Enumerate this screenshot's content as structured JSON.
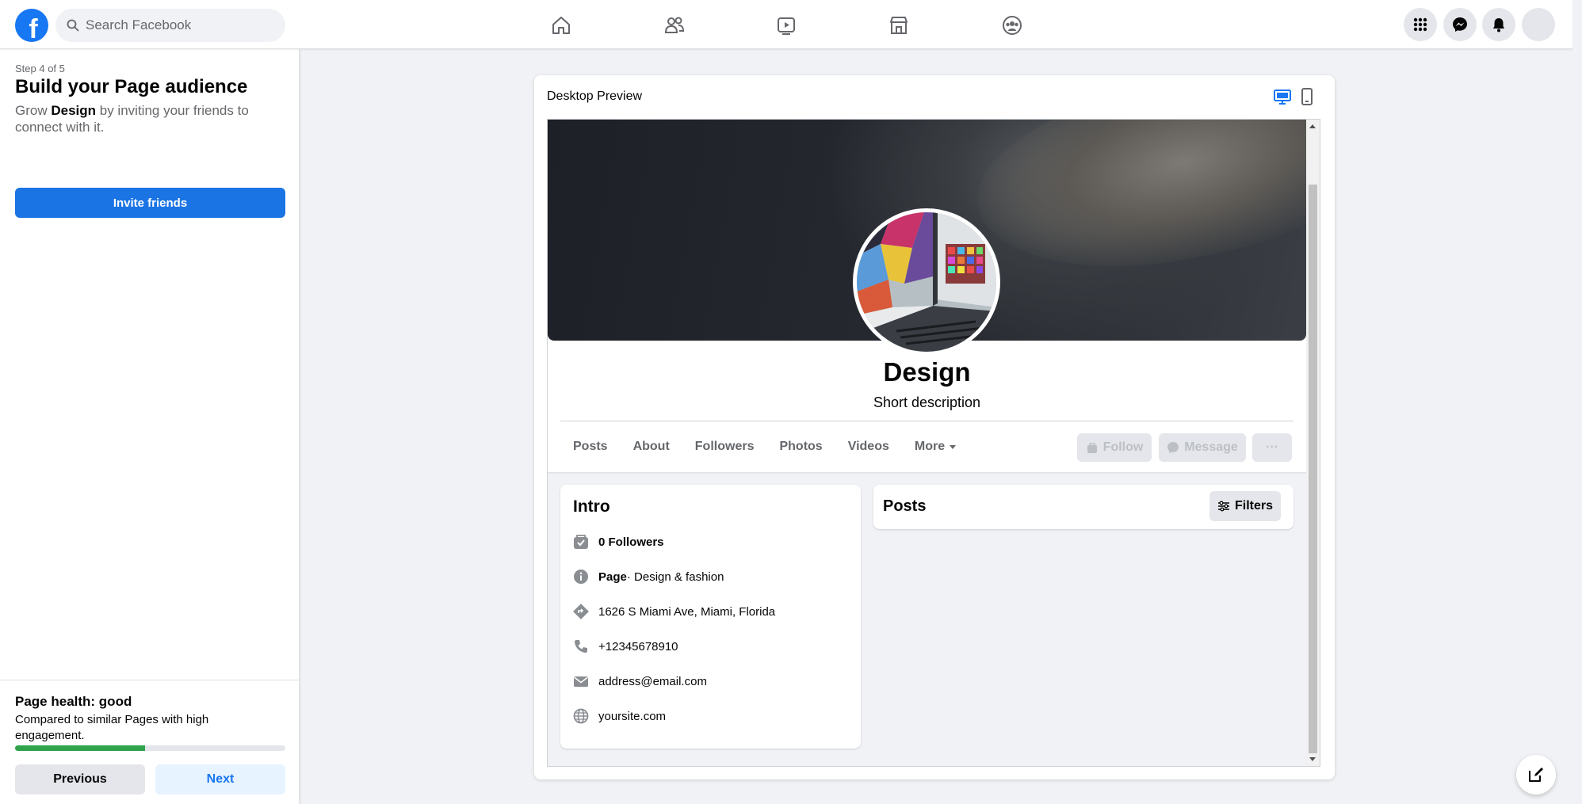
{
  "topbar": {
    "logo_letter": "f",
    "search_placeholder": "Search Facebook",
    "nav": [
      "home-icon",
      "friends-icon",
      "watch-icon",
      "marketplace-icon",
      "groups-icon"
    ],
    "right": [
      "menu-grid-icon",
      "messenger-icon",
      "notifications-icon",
      "account-icon"
    ]
  },
  "left": {
    "step": "Step 4 of 5",
    "title": "Build your Page audience",
    "grow_prefix": "Grow ",
    "grow_name": "Design",
    "grow_suffix": " by inviting your friends to connect with it.",
    "invite_label": "Invite friends",
    "health_title": "Page health: good",
    "health_desc": "Compared to similar Pages with high engagement.",
    "health_progress": 0.48,
    "previous_label": "Previous",
    "next_label": "Next"
  },
  "preview": {
    "title": "Desktop Preview",
    "page_name": "Design",
    "short_description": "Short description",
    "tabs": [
      "Posts",
      "About",
      "Followers",
      "Photos",
      "Videos",
      "More"
    ],
    "follow_label": "Follow",
    "message_label": "Message",
    "more_label": "···",
    "intro": {
      "title": "Intro",
      "followers": "0 Followers",
      "page_label": "Page",
      "page_category": " · Design & fashion",
      "address": "1626 S Miami Ave, Miami, Florida",
      "phone": "+12345678910",
      "email": "address@email.com",
      "website": "yoursite.com"
    },
    "posts_title": "Posts",
    "filters_label": "Filters"
  },
  "colors": {
    "brand": "#1877f2",
    "health": "#31a24c",
    "bg": "#f0f2f5"
  }
}
